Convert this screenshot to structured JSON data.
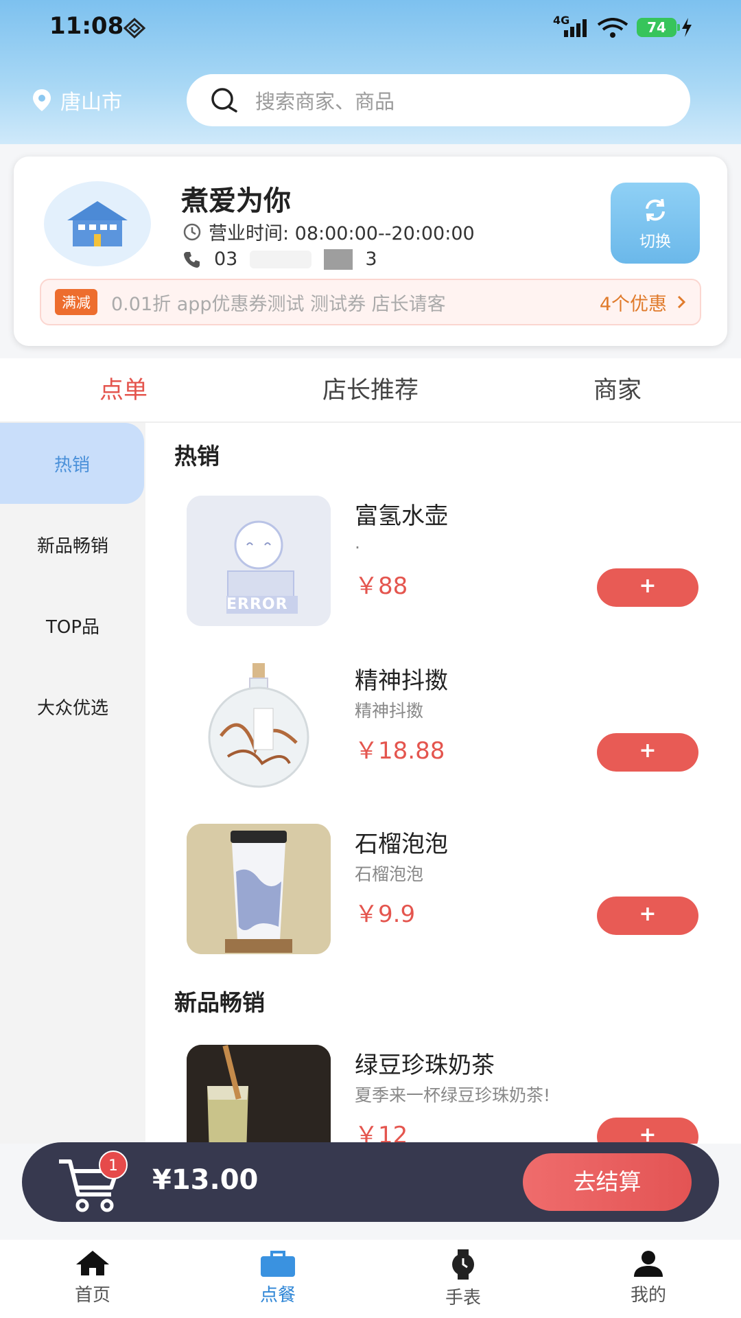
{
  "status_bar": {
    "time": "11:08",
    "network": "4G",
    "battery": "74"
  },
  "header": {
    "location": "唐山市",
    "search_placeholder": "搜索商家、商品"
  },
  "store": {
    "name": "煮爱为你",
    "hours_label": "营业时间: 08:00:00--20:00:00",
    "phone_prefix": "03",
    "phone_suffix": "3",
    "switch_label": "切换",
    "coupon_tag": "满减",
    "coupon_text": "0.01折 app优惠券测试 测试券 店长请客",
    "coupon_count": "4个优惠"
  },
  "tabs": [
    {
      "label": "点单",
      "active": true
    },
    {
      "label": "店长推荐",
      "active": false
    },
    {
      "label": "商家",
      "active": false
    }
  ],
  "categories": [
    {
      "label": "热销",
      "active": true
    },
    {
      "label": "新品畅销",
      "active": false
    },
    {
      "label": "TOP品",
      "active": false
    },
    {
      "label": "大众优选",
      "active": false
    }
  ],
  "sections": [
    {
      "title": "热销",
      "items": [
        {
          "name": "富氢水壶",
          "desc": ".",
          "price": "￥88",
          "add": "+",
          "image": "error-placeholder"
        },
        {
          "name": "精神抖擞",
          "desc": "精神抖擞",
          "price": "￥18.88",
          "add": "+",
          "image": "bottle"
        },
        {
          "name": "石榴泡泡",
          "desc": "石榴泡泡",
          "price": "￥9.9",
          "add": "+",
          "image": "cup"
        }
      ]
    },
    {
      "title": "新品畅销",
      "items": [
        {
          "name": "绿豆珍珠奶茶",
          "desc": "夏季来一杯绿豆珍珠奶茶!",
          "price": "￥12",
          "add": "+",
          "image": "milk-tea"
        }
      ]
    }
  ],
  "error_image_text": "ERROR",
  "cart": {
    "count": "1",
    "total": "¥13.00",
    "checkout_label": "去结算"
  },
  "bottom_nav": [
    {
      "label": "首页",
      "icon": "home-icon",
      "active": false
    },
    {
      "label": "点餐",
      "icon": "bag-icon",
      "active": true
    },
    {
      "label": "手表",
      "icon": "watch-icon",
      "active": false
    },
    {
      "label": "我的",
      "icon": "user-icon",
      "active": false
    }
  ],
  "colors": {
    "accent_red": "#e4554e",
    "accent_blue": "#2f86d6",
    "header_top": "#7dc1ef"
  }
}
